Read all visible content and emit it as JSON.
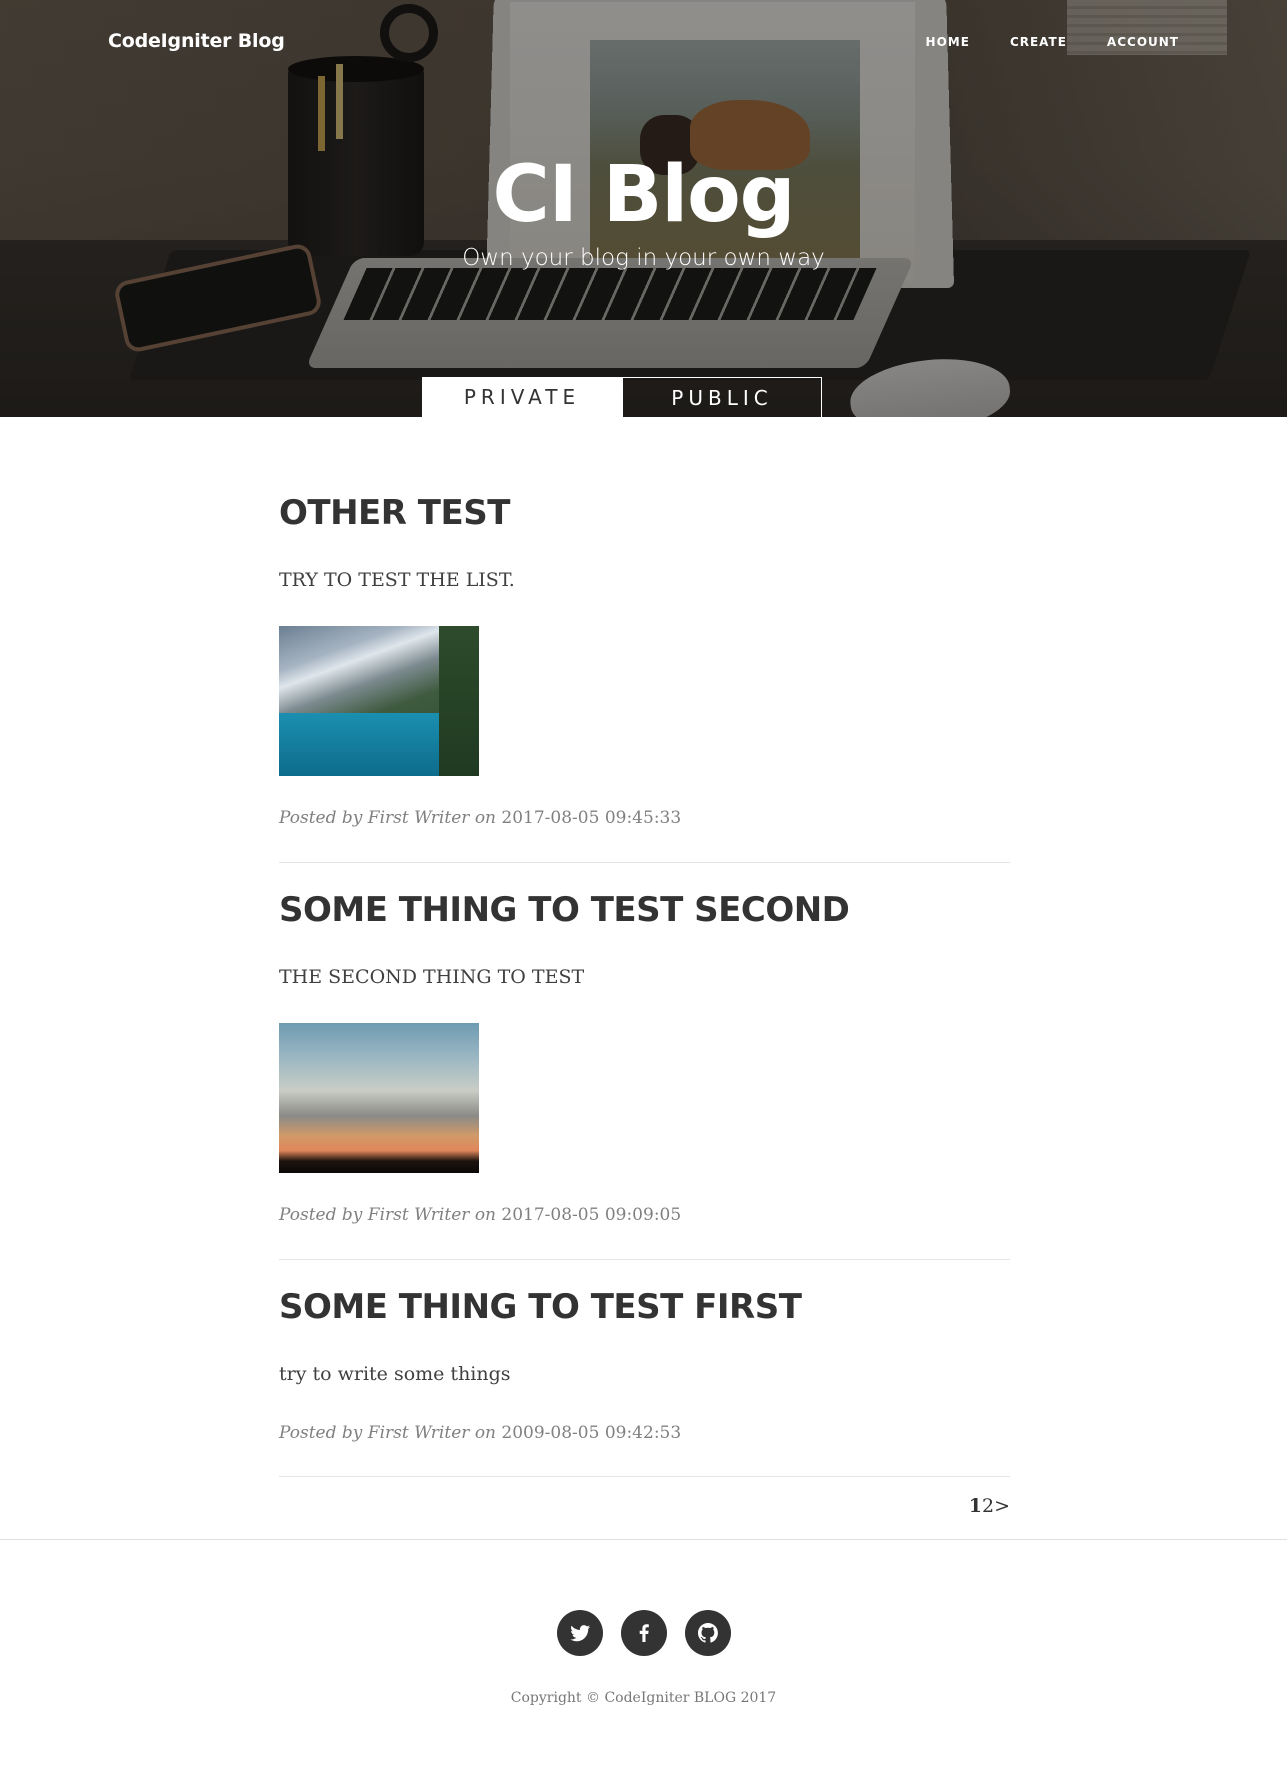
{
  "nav": {
    "brand": "CodeIgniter Blog",
    "links": [
      "HOME",
      "CREATE",
      "ACCOUNT"
    ]
  },
  "hero": {
    "title": "CI Blog",
    "subtitle": "Own your blog in your own way"
  },
  "tabs": [
    "PRIVATE",
    "PUBLIC"
  ],
  "active_tab": "PRIVATE",
  "posts": [
    {
      "title": "OTHER TEST",
      "subtitle": "TRY TO TEST THE LIST.",
      "image": "mountain-lake",
      "meta_prefix": "Posted by",
      "author": "First Writer",
      "meta_on": "on",
      "date": "2017-08-05 09:45:33"
    },
    {
      "title": "SOME THING TO TEST SECOND",
      "subtitle": "THE SECOND THING TO TEST",
      "image": "sunset-clouds",
      "meta_prefix": "Posted by",
      "author": "First Writer",
      "meta_on": "on",
      "date": "2017-08-05 09:09:05"
    },
    {
      "title": "SOME THING TO TEST FIRST",
      "subtitle": "try to write some things",
      "meta_prefix": "Posted by",
      "author": "First Writer",
      "meta_on": "on",
      "date": "2009-08-05 09:42:53"
    }
  ],
  "pagination": {
    "current": "1",
    "next_page": "2",
    "next_arrow": ">"
  },
  "footer": {
    "socials": [
      "twitter-icon",
      "facebook-icon",
      "github-icon"
    ],
    "copyright": "Copyright © CodeIgniter BLOG 2017"
  },
  "colors": {
    "text": "#333333",
    "meta": "#808080",
    "hero_overlay": "rgba(0,0,0,0.38)"
  }
}
